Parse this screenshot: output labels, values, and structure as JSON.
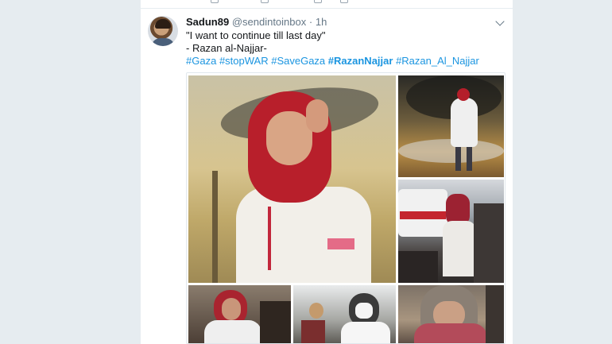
{
  "tweet": {
    "display_name": "Sadun89",
    "handle": "@sendintoinbox",
    "separator": "·",
    "time": "1h",
    "line1": "\"I want to continue till last day\"",
    "line2": " - Razan al-Najjar-",
    "hashtags": [
      "#Gaza",
      "#stopWAR",
      "#SaveGaza",
      "#RazanNajjar",
      "#Razan_Al_Najjar"
    ]
  },
  "colors": {
    "page_background": "#e6ecf0",
    "link": "#1b95e0",
    "text": "#14171a",
    "muted": "#657786"
  },
  "icons": {
    "menu": "chevron-down-icon",
    "prev_actions": [
      "reply-icon",
      "retweet-icon",
      "like-icon",
      "message-icon"
    ]
  },
  "media": {
    "photo_count": 6
  }
}
